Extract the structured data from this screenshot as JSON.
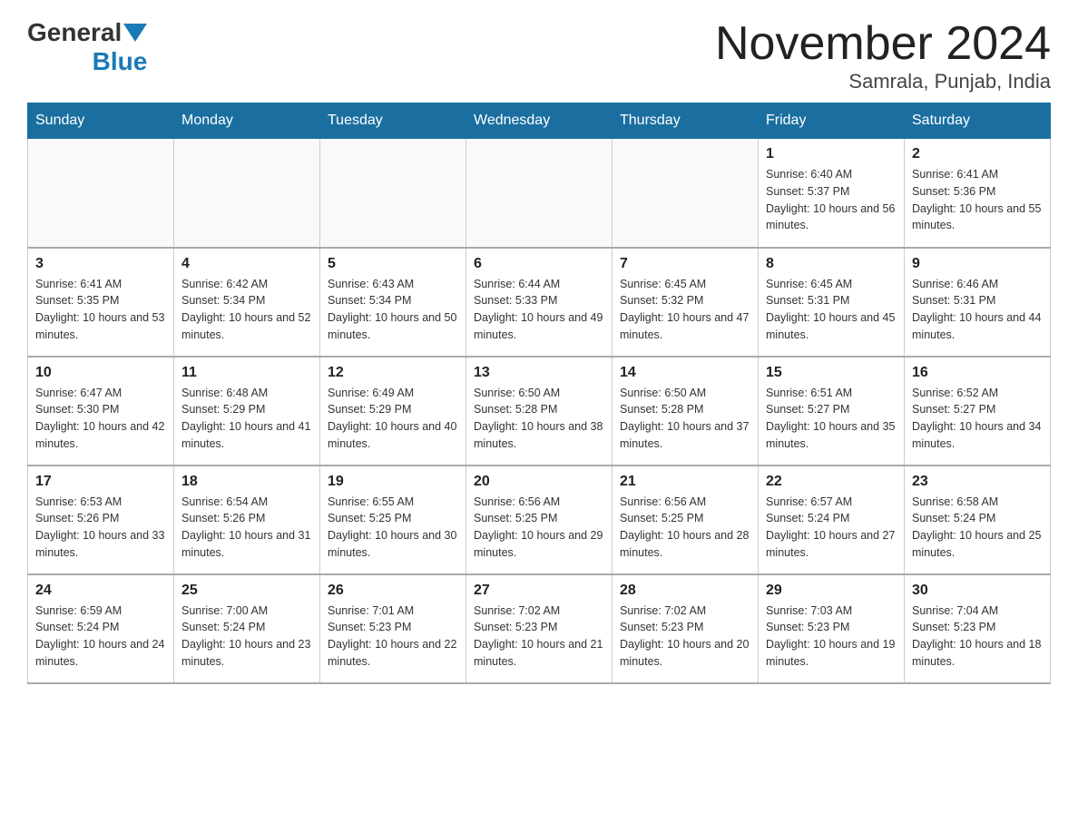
{
  "header": {
    "logo_general": "General",
    "logo_blue": "Blue",
    "month_title": "November 2024",
    "location": "Samrala, Punjab, India"
  },
  "weekdays": [
    "Sunday",
    "Monday",
    "Tuesday",
    "Wednesday",
    "Thursday",
    "Friday",
    "Saturday"
  ],
  "weeks": [
    [
      {
        "day": "",
        "info": ""
      },
      {
        "day": "",
        "info": ""
      },
      {
        "day": "",
        "info": ""
      },
      {
        "day": "",
        "info": ""
      },
      {
        "day": "",
        "info": ""
      },
      {
        "day": "1",
        "info": "Sunrise: 6:40 AM\nSunset: 5:37 PM\nDaylight: 10 hours and 56 minutes."
      },
      {
        "day": "2",
        "info": "Sunrise: 6:41 AM\nSunset: 5:36 PM\nDaylight: 10 hours and 55 minutes."
      }
    ],
    [
      {
        "day": "3",
        "info": "Sunrise: 6:41 AM\nSunset: 5:35 PM\nDaylight: 10 hours and 53 minutes."
      },
      {
        "day": "4",
        "info": "Sunrise: 6:42 AM\nSunset: 5:34 PM\nDaylight: 10 hours and 52 minutes."
      },
      {
        "day": "5",
        "info": "Sunrise: 6:43 AM\nSunset: 5:34 PM\nDaylight: 10 hours and 50 minutes."
      },
      {
        "day": "6",
        "info": "Sunrise: 6:44 AM\nSunset: 5:33 PM\nDaylight: 10 hours and 49 minutes."
      },
      {
        "day": "7",
        "info": "Sunrise: 6:45 AM\nSunset: 5:32 PM\nDaylight: 10 hours and 47 minutes."
      },
      {
        "day": "8",
        "info": "Sunrise: 6:45 AM\nSunset: 5:31 PM\nDaylight: 10 hours and 45 minutes."
      },
      {
        "day": "9",
        "info": "Sunrise: 6:46 AM\nSunset: 5:31 PM\nDaylight: 10 hours and 44 minutes."
      }
    ],
    [
      {
        "day": "10",
        "info": "Sunrise: 6:47 AM\nSunset: 5:30 PM\nDaylight: 10 hours and 42 minutes."
      },
      {
        "day": "11",
        "info": "Sunrise: 6:48 AM\nSunset: 5:29 PM\nDaylight: 10 hours and 41 minutes."
      },
      {
        "day": "12",
        "info": "Sunrise: 6:49 AM\nSunset: 5:29 PM\nDaylight: 10 hours and 40 minutes."
      },
      {
        "day": "13",
        "info": "Sunrise: 6:50 AM\nSunset: 5:28 PM\nDaylight: 10 hours and 38 minutes."
      },
      {
        "day": "14",
        "info": "Sunrise: 6:50 AM\nSunset: 5:28 PM\nDaylight: 10 hours and 37 minutes."
      },
      {
        "day": "15",
        "info": "Sunrise: 6:51 AM\nSunset: 5:27 PM\nDaylight: 10 hours and 35 minutes."
      },
      {
        "day": "16",
        "info": "Sunrise: 6:52 AM\nSunset: 5:27 PM\nDaylight: 10 hours and 34 minutes."
      }
    ],
    [
      {
        "day": "17",
        "info": "Sunrise: 6:53 AM\nSunset: 5:26 PM\nDaylight: 10 hours and 33 minutes."
      },
      {
        "day": "18",
        "info": "Sunrise: 6:54 AM\nSunset: 5:26 PM\nDaylight: 10 hours and 31 minutes."
      },
      {
        "day": "19",
        "info": "Sunrise: 6:55 AM\nSunset: 5:25 PM\nDaylight: 10 hours and 30 minutes."
      },
      {
        "day": "20",
        "info": "Sunrise: 6:56 AM\nSunset: 5:25 PM\nDaylight: 10 hours and 29 minutes."
      },
      {
        "day": "21",
        "info": "Sunrise: 6:56 AM\nSunset: 5:25 PM\nDaylight: 10 hours and 28 minutes."
      },
      {
        "day": "22",
        "info": "Sunrise: 6:57 AM\nSunset: 5:24 PM\nDaylight: 10 hours and 27 minutes."
      },
      {
        "day": "23",
        "info": "Sunrise: 6:58 AM\nSunset: 5:24 PM\nDaylight: 10 hours and 25 minutes."
      }
    ],
    [
      {
        "day": "24",
        "info": "Sunrise: 6:59 AM\nSunset: 5:24 PM\nDaylight: 10 hours and 24 minutes."
      },
      {
        "day": "25",
        "info": "Sunrise: 7:00 AM\nSunset: 5:24 PM\nDaylight: 10 hours and 23 minutes."
      },
      {
        "day": "26",
        "info": "Sunrise: 7:01 AM\nSunset: 5:23 PM\nDaylight: 10 hours and 22 minutes."
      },
      {
        "day": "27",
        "info": "Sunrise: 7:02 AM\nSunset: 5:23 PM\nDaylight: 10 hours and 21 minutes."
      },
      {
        "day": "28",
        "info": "Sunrise: 7:02 AM\nSunset: 5:23 PM\nDaylight: 10 hours and 20 minutes."
      },
      {
        "day": "29",
        "info": "Sunrise: 7:03 AM\nSunset: 5:23 PM\nDaylight: 10 hours and 19 minutes."
      },
      {
        "day": "30",
        "info": "Sunrise: 7:04 AM\nSunset: 5:23 PM\nDaylight: 10 hours and 18 minutes."
      }
    ]
  ]
}
